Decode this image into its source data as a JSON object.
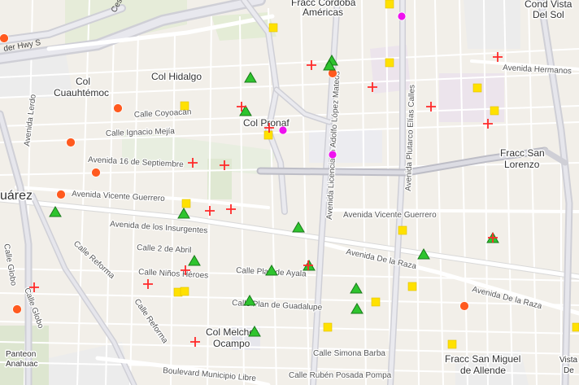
{
  "labels": {
    "districts": {
      "fracc_cordoba": "Fracc Córdoba",
      "americas": "Américas",
      "cond_vista": "Cond Vista",
      "del_sol": "Del Sol",
      "col_hidalgo": "Col Hidalgo",
      "col": "Col",
      "cuauhtemoc": "Cuauhtémoc",
      "col_pronaf": "Col Pronaf",
      "fracc_san": "Fracc San",
      "lorenzo": "Lorenzo",
      "juarez": "uárez",
      "col_melchor": "Col Melchor",
      "ocampo": "Ocampo",
      "panteon": "Panteon",
      "anahuac": "Anahuac",
      "fracc_san_miguel": "Fracc San Miguel",
      "de_allende": "de Allende",
      "vista_s": "Vista S",
      "de": "De"
    },
    "streets": {
      "border_hwy": "der Hwy S",
      "ces": "Ces",
      "lerdo": "Avenida Lerdo",
      "coyoacan": "Calle Coyoacán",
      "ignacio_mejia": "Calle Ignacio Mejía",
      "dieciseis_sept": "Avenida 16 de Septiembre",
      "vicente_guerrero_w": "Avenida Vicente Guerrero",
      "vicente_guerrero_e": "Avenida Vicente Guerrero",
      "insurgentes": "Avenida de los Insurgentes",
      "dos_abril": "Calle 2 de Abril",
      "ninos_heroes": "Calle Niños Héroes",
      "plan_ayala": "Calle Plan de Ayala",
      "plan_guadalupe": "Calle Plan de Guadalupe",
      "reforma_1": "Calle Reforma",
      "reforma_2": "Calle Reforma",
      "globo_1": "Calle Globo",
      "globo_2": "Calle Globo",
      "de_la_raza_1": "Avenida De la Raza",
      "de_la_raza_2": "Avenida De la Raza",
      "lopez_mateos": "Avenida Licenciado Adolfo López Mateos",
      "plutarco": "Avenida Plutarco Elías Calles",
      "hermanos": "Avenida Hermanos",
      "simona_barba": "Calle Simona Barba",
      "posada_pompa": "Calle Rubén Posada Pompa",
      "boulevard_municipio": "Boulevard Municipio Libre"
    }
  },
  "markers": {
    "colors": {
      "red_circle": "#ff5a1f",
      "yellow_square": "#ffe100",
      "green_triangle": "#2ec42e",
      "magenta_circle": "#ee11ee",
      "red_cross": "#ff2a2a"
    }
  }
}
